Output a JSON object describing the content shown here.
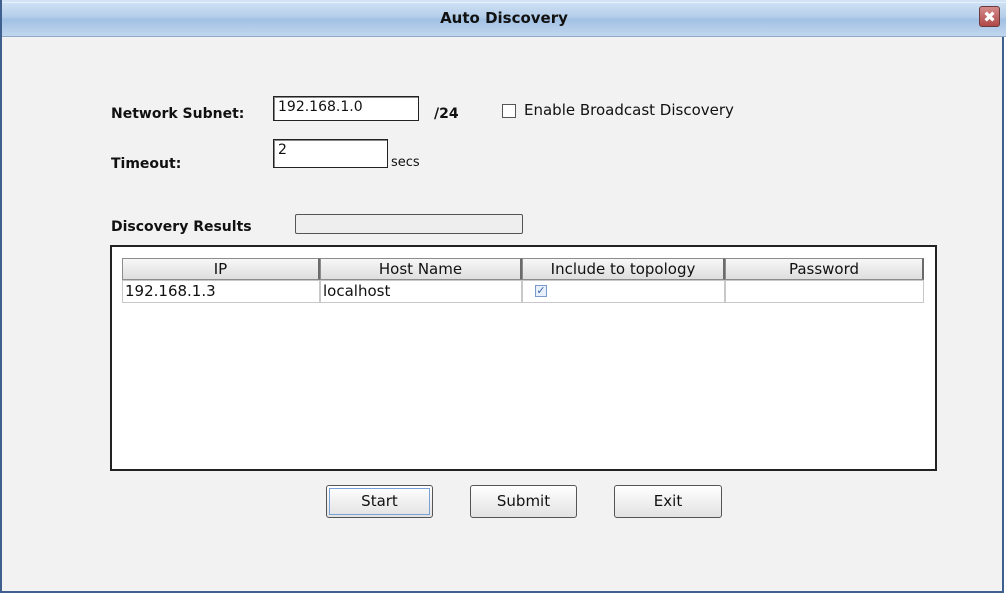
{
  "window": {
    "title": "Auto Discovery",
    "close_glyph": "✖"
  },
  "form": {
    "subnet_label": "Network Subnet:",
    "subnet_value": "192.168.1.0",
    "subnet_suffix": "/24",
    "broadcast_label": "Enable Broadcast Discovery",
    "broadcast_checked": false,
    "timeout_label": "Timeout:",
    "timeout_value": "2",
    "timeout_unit": "secs",
    "results_label": "Discovery Results",
    "progress": 0
  },
  "table": {
    "columns": [
      "IP",
      "Host Name",
      "Include to topology",
      "Password"
    ],
    "rows": [
      {
        "ip": "192.168.1.3",
        "host": "localhost",
        "include": true,
        "password": ""
      }
    ]
  },
  "buttons": {
    "start": "Start",
    "submit": "Submit",
    "exit": "Exit"
  },
  "colors": {
    "title_gradient": "#b6cfea",
    "progress_fill": "#5a7fb5"
  }
}
